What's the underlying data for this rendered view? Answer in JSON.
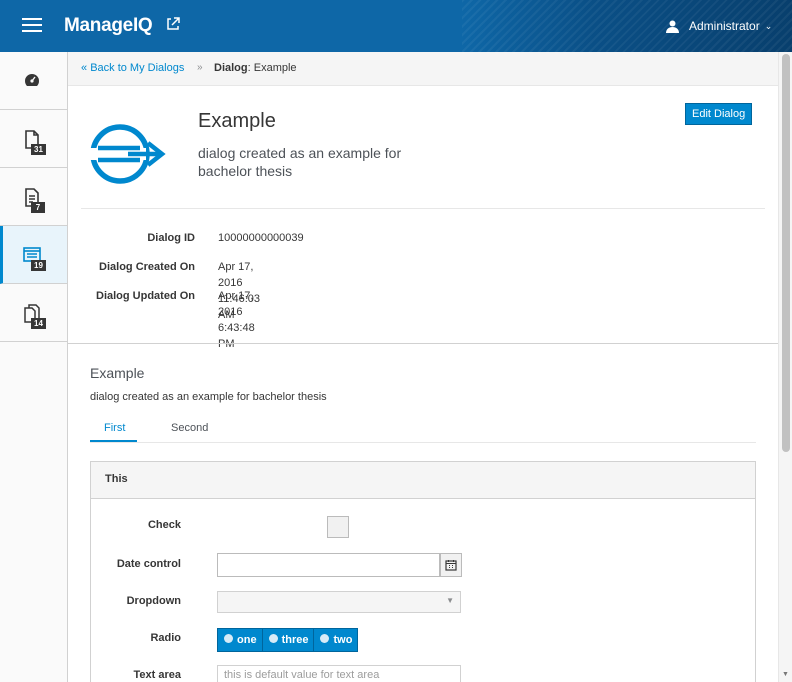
{
  "nav": {
    "brand": "ManageIQ",
    "user": "Administrator"
  },
  "sidebar": {
    "items": [
      {
        "icon": "dashboard-icon",
        "badge": ""
      },
      {
        "icon": "file-icon",
        "badge": "31"
      },
      {
        "icon": "document-list-icon",
        "badge": "7"
      },
      {
        "icon": "dialog-list-icon",
        "badge": "19",
        "active": true
      },
      {
        "icon": "copy-files-icon",
        "badge": "14"
      }
    ]
  },
  "breadcrumb": {
    "back": "Back to My Dialogs",
    "current_prefix": "Dialog",
    "current_name": ": Example"
  },
  "dialog": {
    "edit_button": "Edit Dialog",
    "title": "Example",
    "description": "dialog created as an example for bachelor thesis"
  },
  "properties": [
    {
      "label": "Dialog ID",
      "value": "10000000000039"
    },
    {
      "label": "Dialog Created On",
      "value": "Apr 17, 2016 11:46:03 AM"
    },
    {
      "label": "Dialog Updated On",
      "value": "Apr 17, 2016 6:43:48 PM"
    }
  ],
  "form": {
    "title": "Example",
    "description": "dialog created as an example for bachelor thesis",
    "tabs": [
      "First",
      "Second"
    ],
    "active_tab": "First",
    "section": "This",
    "fields": {
      "check": "Check",
      "date": "Date control",
      "dropdown": "Dropdown",
      "radio": "Radio",
      "textarea": "Text area"
    },
    "radio_options": [
      "one",
      "three",
      "two"
    ],
    "textarea_placeholder": "this is default value for text area"
  },
  "colors": {
    "nav": "#0e67a7",
    "accent": "#0088ce"
  }
}
